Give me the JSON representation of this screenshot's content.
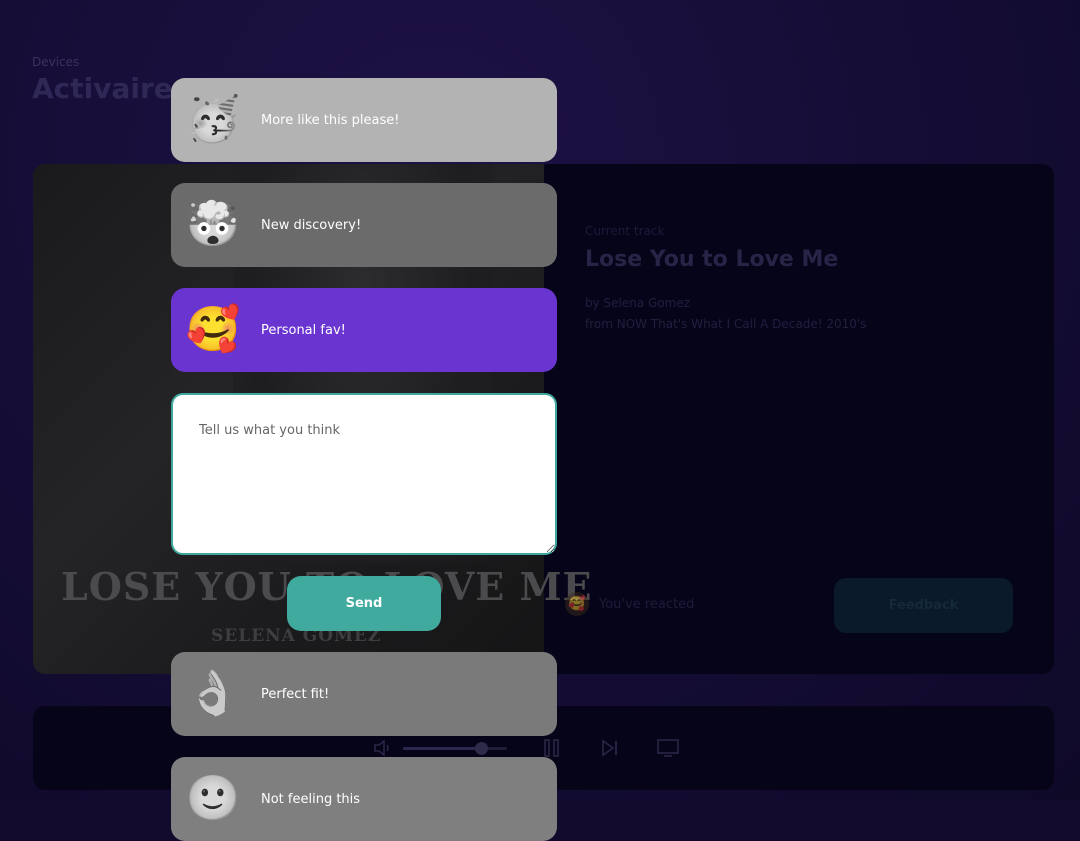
{
  "header": {
    "section": "Devices",
    "device_name": "Activaire"
  },
  "album": {
    "cover_title": "LOSE YOU TO LOVE ME",
    "cover_artist": "SELENA GOMEZ"
  },
  "track": {
    "label": "Current track",
    "title": "Lose You to Love Me",
    "artist": "by Selena Gomez",
    "album": "from NOW That's What I Call A Decade! 2010's"
  },
  "reaction_status": {
    "emoji": "🥰",
    "text": "You've reacted"
  },
  "feedback_button": "Feedback",
  "player_controls": {
    "volume_fraction": 0.75,
    "volume_icon": "speaker-icon",
    "pause_icon": "pause-icon",
    "next_icon": "skip-next-icon",
    "cast_icon": "monitor-icon"
  },
  "reactions": [
    {
      "emoji": "🥳",
      "label": "More like this please!"
    },
    {
      "emoji": "🤯",
      "label": "New discovery!"
    },
    {
      "emoji": "🥰",
      "label": "Personal fav!"
    },
    {
      "emoji": "👌",
      "label": "Perfect fit!"
    },
    {
      "emoji": "🙂",
      "label": "Not feeling this"
    }
  ],
  "feedback_form": {
    "placeholder": "Tell us what you think",
    "value": "",
    "send_label": "Send"
  },
  "colors": {
    "selected_reaction": "#6a34d1",
    "send_button": "#40aa9e",
    "textarea_border": "#3fa89e"
  }
}
